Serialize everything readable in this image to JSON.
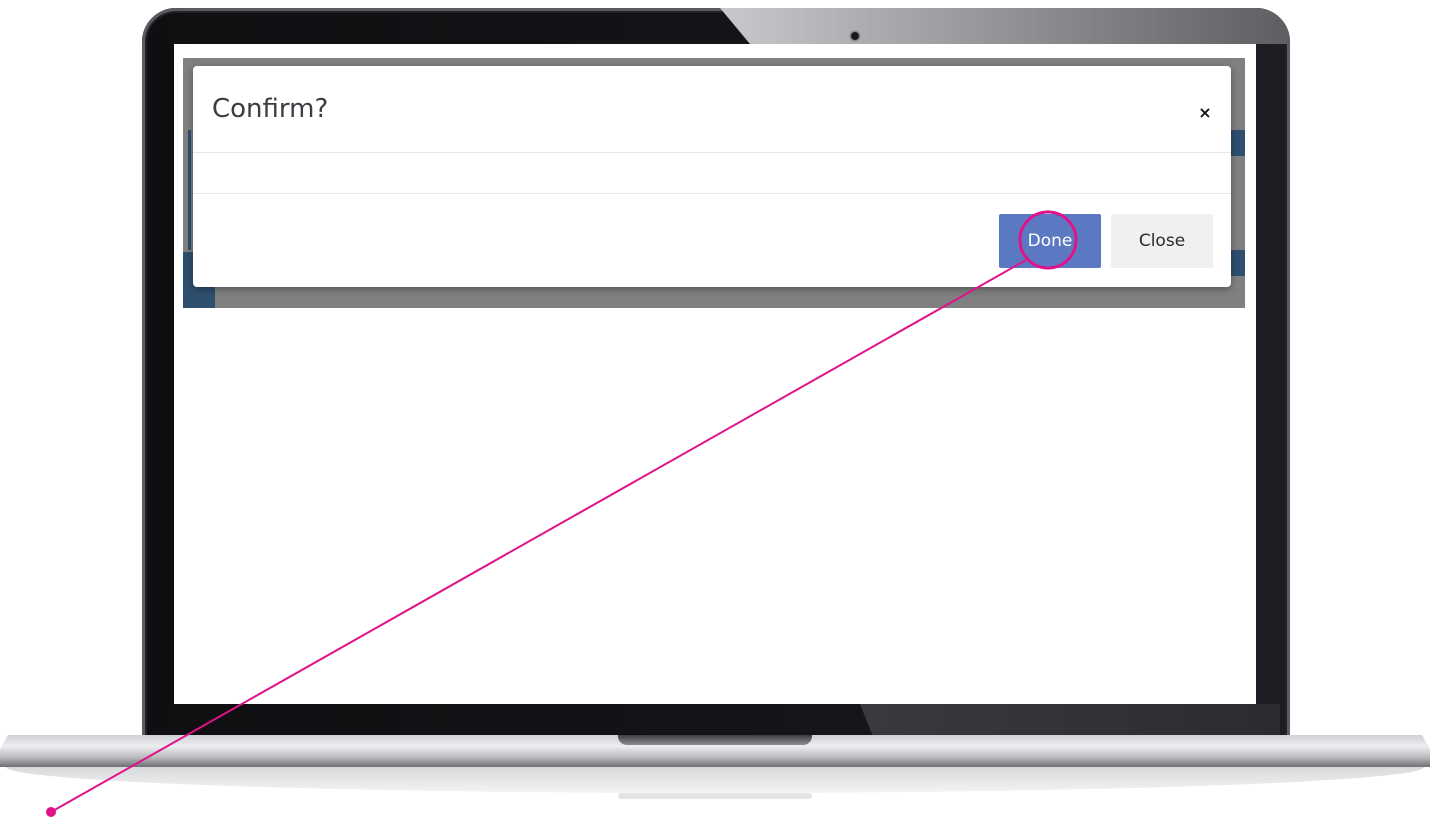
{
  "dialog": {
    "title": "Confirm?",
    "close_icon_glyph": "×",
    "close_icon": "close-icon",
    "buttons": {
      "done_label": "Done",
      "close_label": "Close"
    }
  },
  "colors": {
    "done_button_bg": "#5b79c2",
    "close_button_bg": "#f0f0f0",
    "backdrop": "#808080",
    "backdrop_accent": "#2e4f6e",
    "annotation": "#e0128a"
  },
  "annotation": {
    "type": "callout",
    "target": "done-button"
  }
}
